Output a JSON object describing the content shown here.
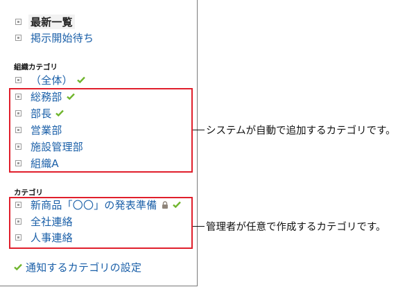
{
  "sidebar": {
    "top_items": [
      {
        "label": "最新一覧",
        "selected": true
      },
      {
        "label": "掲示開始待ち",
        "selected": false
      }
    ],
    "system_section": {
      "title": "組織カテゴリ",
      "all_item": {
        "label": "（全体）",
        "subscribed": true
      },
      "items": [
        {
          "label": "総務部",
          "subscribed": true
        },
        {
          "label": "部長",
          "subscribed": true
        },
        {
          "label": "営業部",
          "subscribed": false
        },
        {
          "label": "施設管理部",
          "subscribed": false
        },
        {
          "label": "組織A",
          "subscribed": false
        }
      ]
    },
    "admin_section": {
      "title": "カテゴリ",
      "items": [
        {
          "label": "新商品「〇〇」の発表準備",
          "subscribed": true,
          "restricted": true
        },
        {
          "label": "全社連絡",
          "subscribed": false
        },
        {
          "label": "人事連絡",
          "subscribed": false
        }
      ]
    },
    "notification_settings_label": "通知するカテゴリの設定"
  },
  "annotations": {
    "system_categories": "システムが自動で追加するカテゴリです。",
    "admin_categories": "管理者が任意で作成するカテゴリです。"
  },
  "colors": {
    "link": "#1a5fa8",
    "highlight_box": "#e01e2b",
    "check": "#6fb52c"
  },
  "icons": {
    "bullet": "square-bullet-icon",
    "subscribed": "check-icon",
    "restricted": "lock-icon"
  }
}
